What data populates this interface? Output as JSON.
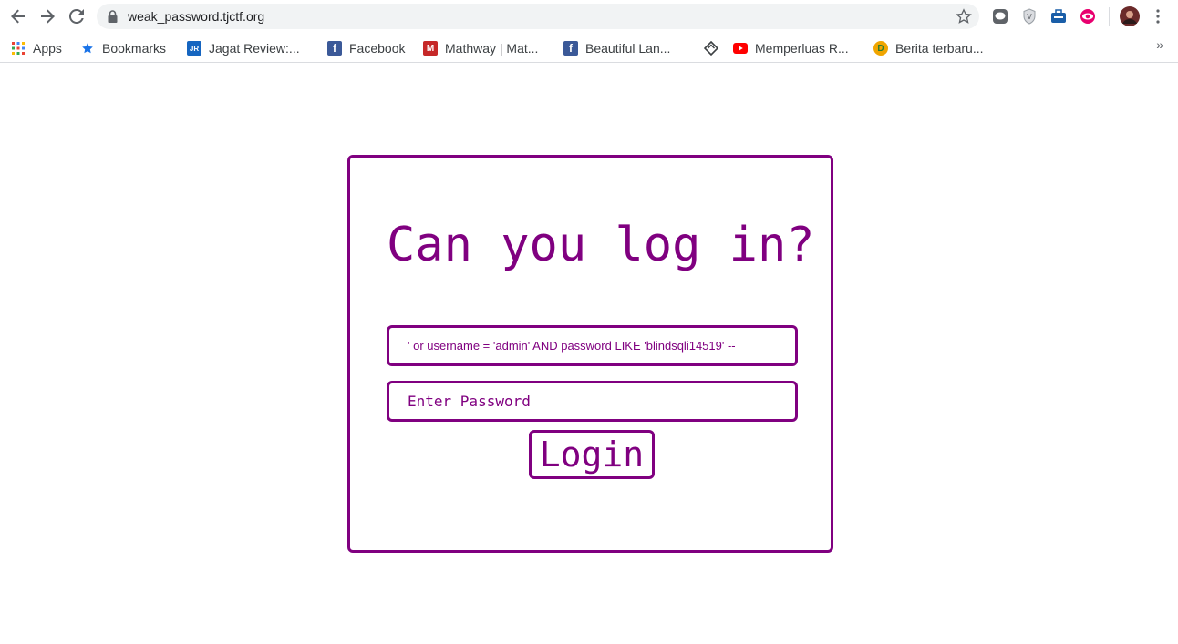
{
  "browser": {
    "url": "weak_password.tjctf.org",
    "icons": {
      "back": "arrow-left-icon",
      "forward": "arrow-right-icon",
      "reload": "reload-icon",
      "lock": "lock-icon",
      "star": "star-icon",
      "menu": "kebab-menu-icon"
    }
  },
  "bookmarks": [
    {
      "label": "Apps",
      "icon": "apps-grid-icon"
    },
    {
      "label": "Bookmarks",
      "icon": "star-icon"
    },
    {
      "label": "Jagat Review:...",
      "icon": "jagat-review-icon"
    },
    {
      "label": "Facebook",
      "icon": "facebook-icon"
    },
    {
      "label": "Mathway | Mat...",
      "icon": "mathway-icon"
    },
    {
      "label": "Beautiful Lan...",
      "icon": "facebook-icon"
    },
    {
      "label": "",
      "icon": "diamond-icon"
    },
    {
      "label": "Memperluas R...",
      "icon": "youtube-icon"
    },
    {
      "label": "Berita terbaru...",
      "icon": "detik-icon"
    }
  ],
  "bookmarks_overflow": "»",
  "login": {
    "title": "Can you log in?",
    "username_value": "' or username = 'admin' AND password LIKE 'blindsqli14519' --",
    "password_placeholder": "Enter Password",
    "button_label": "Login"
  },
  "colors": {
    "accent": "#800080"
  }
}
